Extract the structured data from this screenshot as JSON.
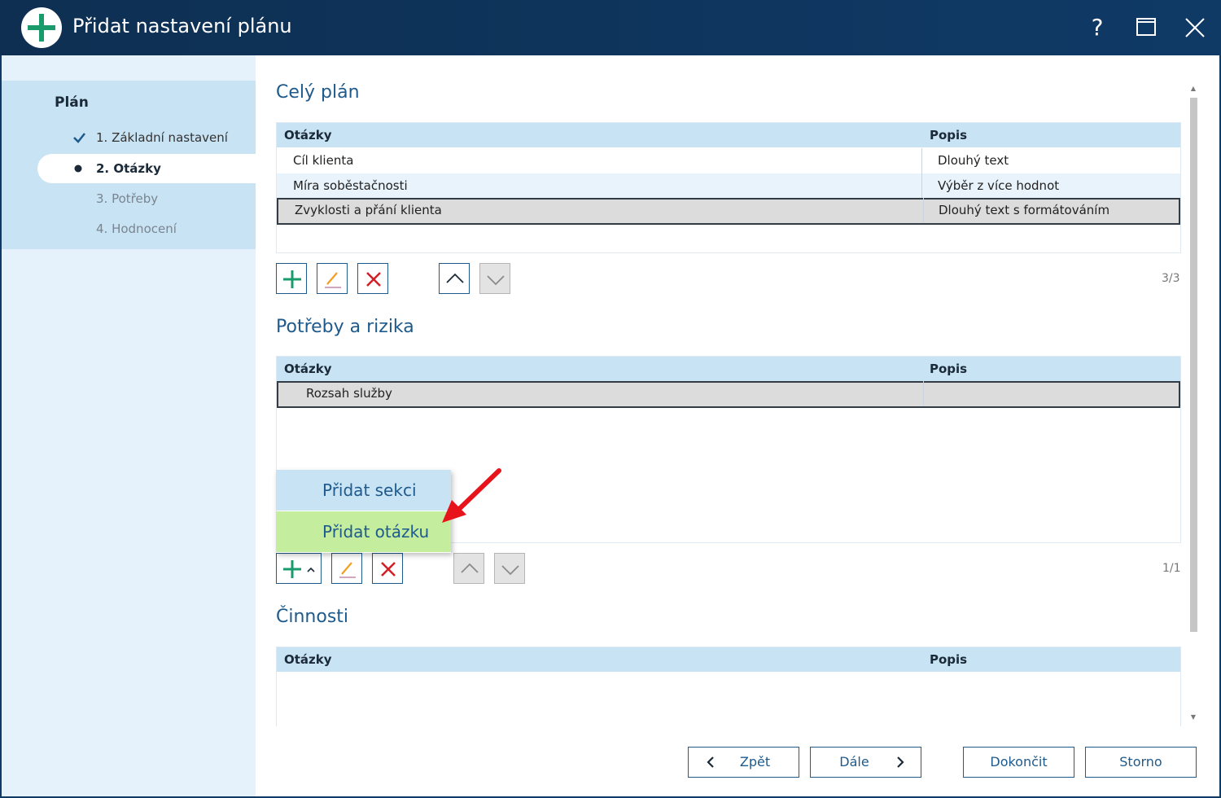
{
  "window": {
    "title": "Přidat nastavení plánu",
    "help_label": "?",
    "icons": {
      "app": "add-circle-icon",
      "maximize": "maximize-icon",
      "close": "close-icon"
    }
  },
  "sidebar": {
    "heading": "Plán",
    "steps": [
      {
        "label": "1. Základní nastavení",
        "state": "done",
        "icon": "check-icon"
      },
      {
        "label": "2. Otázky",
        "state": "active",
        "icon": "bullet-icon"
      },
      {
        "label": "3. Potřeby",
        "state": "pending"
      },
      {
        "label": "4. Hodnocení",
        "state": "pending"
      }
    ]
  },
  "sections": [
    {
      "title": "Celý plán",
      "columns": [
        "Otázky",
        "Popis"
      ],
      "rows": [
        {
          "question": "Cíl klienta",
          "description": "Dlouhý text"
        },
        {
          "question": "Míra soběstačnosti",
          "description": "Výběr z více hodnot"
        },
        {
          "question": "Zvyklosti a přání klienta",
          "description": "Dlouhý text s formátováním",
          "selected": true
        }
      ],
      "counter": "3/3"
    },
    {
      "title": "Potřeby a rizika",
      "columns": [
        "Otázky",
        "Popis"
      ],
      "rows": [
        {
          "question": "Rozsah služby",
          "description": "",
          "selected": true
        }
      ],
      "counter": "1/1"
    },
    {
      "title": "Činnosti",
      "columns": [
        "Otázky",
        "Popis"
      ],
      "rows": []
    }
  ],
  "add_menu": {
    "items": [
      "Přidat sekci",
      "Přidat otázku"
    ],
    "highlighted": "Přidat otázku"
  },
  "footer": {
    "back": "Zpět",
    "next": "Dále",
    "finish": "Dokončit",
    "cancel": "Storno"
  },
  "colors": {
    "titlebar": "#0f3a66",
    "accent": "#1e5a8c",
    "header_bg": "#c8e3f4",
    "add_green": "#1a9b6c",
    "delete_red": "#d32027",
    "edit_orange": "#f0a020",
    "menu_highlight": "#c5ed9e",
    "annotation_red": "#e8141b"
  }
}
